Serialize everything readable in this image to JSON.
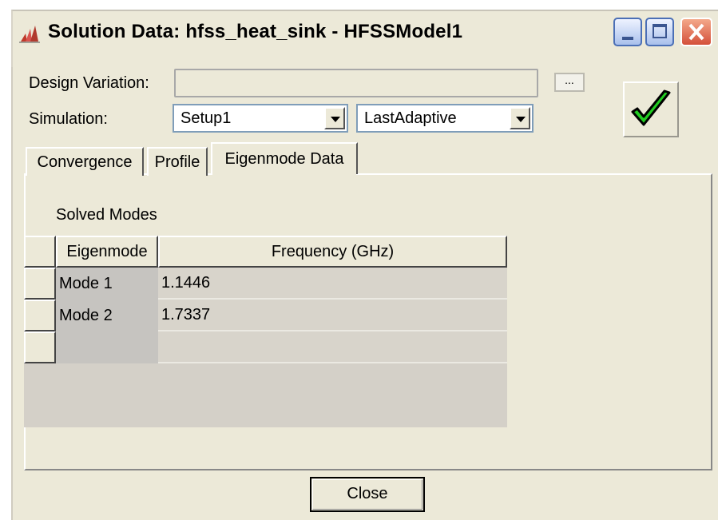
{
  "window": {
    "title": "Solution Data: hfss_heat_sink - HFSSModel1",
    "icon": "hfss-app-icon",
    "controls": [
      "minimize-icon",
      "maximize-icon",
      "close-icon"
    ]
  },
  "form": {
    "design_variation_label": "Design Variation:",
    "design_variation_value": "",
    "browse_label": "...",
    "simulation_label": "Simulation:",
    "setup_value": "Setup1",
    "solution_value": "LastAdaptive",
    "ok_icon": "checkmark-icon",
    "ok_color": "#22cc22"
  },
  "tabs": [
    {
      "label": "Convergence",
      "active": false
    },
    {
      "label": "Profile",
      "active": false
    },
    {
      "label": "Eigenmode Data",
      "active": true
    }
  ],
  "eigenmode": {
    "section_label": "Solved Modes",
    "columns": [
      "Eigenmode",
      "Frequency (GHz)"
    ],
    "rows": [
      {
        "mode": "Mode 1",
        "frequency": "1.1446"
      },
      {
        "mode": "Mode 2",
        "frequency": "1.7337"
      },
      {
        "mode": "",
        "frequency": ""
      }
    ]
  },
  "footer": {
    "close_label": "Close"
  }
}
